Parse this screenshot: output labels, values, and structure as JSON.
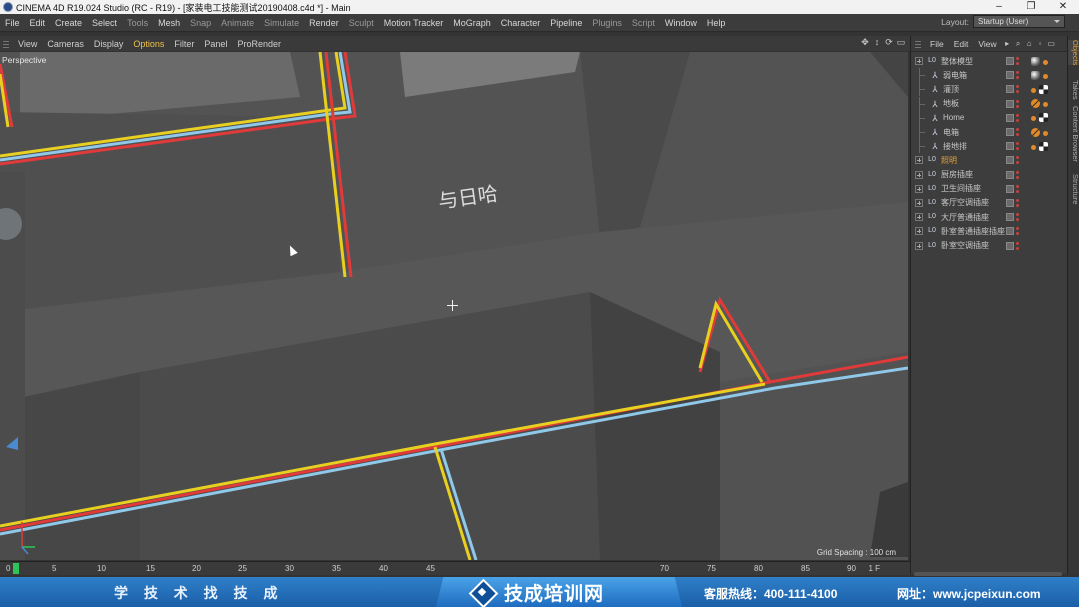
{
  "window": {
    "title": "CINEMA 4D R19.024 Studio (RC - R19) - [家装电工技能测试20190408.c4d *] - Main",
    "controls": [
      "–",
      "❐",
      "✕"
    ]
  },
  "menu": [
    {
      "label": "File",
      "dim": false
    },
    {
      "label": "Edit",
      "dim": false
    },
    {
      "label": "Create",
      "dim": false
    },
    {
      "label": "Select",
      "dim": false
    },
    {
      "label": "Tools",
      "dim": true
    },
    {
      "label": "Mesh",
      "dim": false
    },
    {
      "label": "Snap",
      "dim": true
    },
    {
      "label": "Animate",
      "dim": true
    },
    {
      "label": "Simulate",
      "dim": true
    },
    {
      "label": "Render",
      "dim": false
    },
    {
      "label": "Sculpt",
      "dim": true
    },
    {
      "label": "Motion Tracker",
      "dim": false
    },
    {
      "label": "MoGraph",
      "dim": false
    },
    {
      "label": "Character",
      "dim": false
    },
    {
      "label": "Pipeline",
      "dim": false
    },
    {
      "label": "Plugins",
      "dim": true
    },
    {
      "label": "Script",
      "dim": true
    },
    {
      "label": "Window",
      "dim": false
    },
    {
      "label": "Help",
      "dim": false
    }
  ],
  "layout": {
    "label": "Layout:",
    "value": "Startup (User)"
  },
  "viewport": {
    "menu": [
      {
        "label": "View",
        "active": false
      },
      {
        "label": "Cameras",
        "active": false
      },
      {
        "label": "Display",
        "active": false
      },
      {
        "label": "Options",
        "active": true
      },
      {
        "label": "Filter",
        "active": false
      },
      {
        "label": "Panel",
        "active": false
      },
      {
        "label": "ProRender",
        "active": false
      }
    ],
    "camera_label": "Perspective",
    "grid_spacing": "Grid Spacing : 100 cm",
    "scene_text": "与日哈",
    "nav_icons": [
      "move-view-icon",
      "zoom-view-icon",
      "rotate-view-icon",
      "maximize-view-icon"
    ]
  },
  "object_manager": {
    "menu": [
      "File",
      "Edit",
      "View"
    ],
    "objects": [
      {
        "name": "整体模型",
        "type": "group",
        "depth": 0,
        "highlight": false,
        "tags": [
          "mat",
          "ph"
        ]
      },
      {
        "name": "弱电箱",
        "type": "figure",
        "depth": 1,
        "highlight": false,
        "tags": [
          "mat",
          "ph"
        ]
      },
      {
        "name": "灌顶",
        "type": "figure",
        "depth": 1,
        "highlight": false,
        "tags": [
          "ph",
          "checker"
        ]
      },
      {
        "name": "地板",
        "type": "figure",
        "depth": 1,
        "highlight": false,
        "tags": [
          "slash",
          "ph"
        ]
      },
      {
        "name": "Home",
        "type": "figure",
        "depth": 1,
        "highlight": false,
        "tags": [
          "ph",
          "checker"
        ]
      },
      {
        "name": "电箱",
        "type": "figure",
        "depth": 1,
        "highlight": false,
        "tags": [
          "slash",
          "ph"
        ]
      },
      {
        "name": "接地排",
        "type": "figure",
        "depth": 1,
        "highlight": false,
        "tags": [
          "ph",
          "checker"
        ]
      },
      {
        "name": "照明",
        "type": "group",
        "depth": 0,
        "highlight": true,
        "tags": []
      },
      {
        "name": "厨房插座",
        "type": "group",
        "depth": 0,
        "highlight": false,
        "tags": []
      },
      {
        "name": "卫生间插座",
        "type": "group",
        "depth": 0,
        "highlight": false,
        "tags": []
      },
      {
        "name": "客厅空调插座",
        "type": "group",
        "depth": 0,
        "highlight": false,
        "tags": []
      },
      {
        "name": "大厅普通插座",
        "type": "group",
        "depth": 0,
        "highlight": false,
        "tags": []
      },
      {
        "name": "卧室普通插座插座",
        "type": "group",
        "depth": 0,
        "highlight": false,
        "tags": []
      },
      {
        "name": "卧室空调插座",
        "type": "group",
        "depth": 0,
        "highlight": false,
        "tags": []
      }
    ]
  },
  "side_tabs": [
    {
      "label": "Objects",
      "active": true
    },
    {
      "label": "Takes",
      "active": false
    },
    {
      "label": "Content Browser",
      "active": false
    },
    {
      "label": "Structure",
      "active": false
    }
  ],
  "timeline": {
    "ticks": [
      "0",
      "5",
      "10",
      "15",
      "20",
      "25",
      "30",
      "35",
      "40",
      "45",
      "70",
      "75",
      "80",
      "85",
      "90"
    ],
    "current_frame": "0",
    "end_frame": "1 F"
  },
  "banner": {
    "slogan": "学 技 术   找 技 成",
    "brand": "技成培训网",
    "hotline": "客服热线：400-111-4100",
    "website": "网址：www.jcpeixun.com"
  },
  "colors": {
    "wire_red": "#e03a3a",
    "wire_yellow": "#e8d020",
    "wire_blue": "#8fc8e8",
    "highlight_orange": "#e0a43a",
    "banner_blue": "#1b5fa8"
  }
}
